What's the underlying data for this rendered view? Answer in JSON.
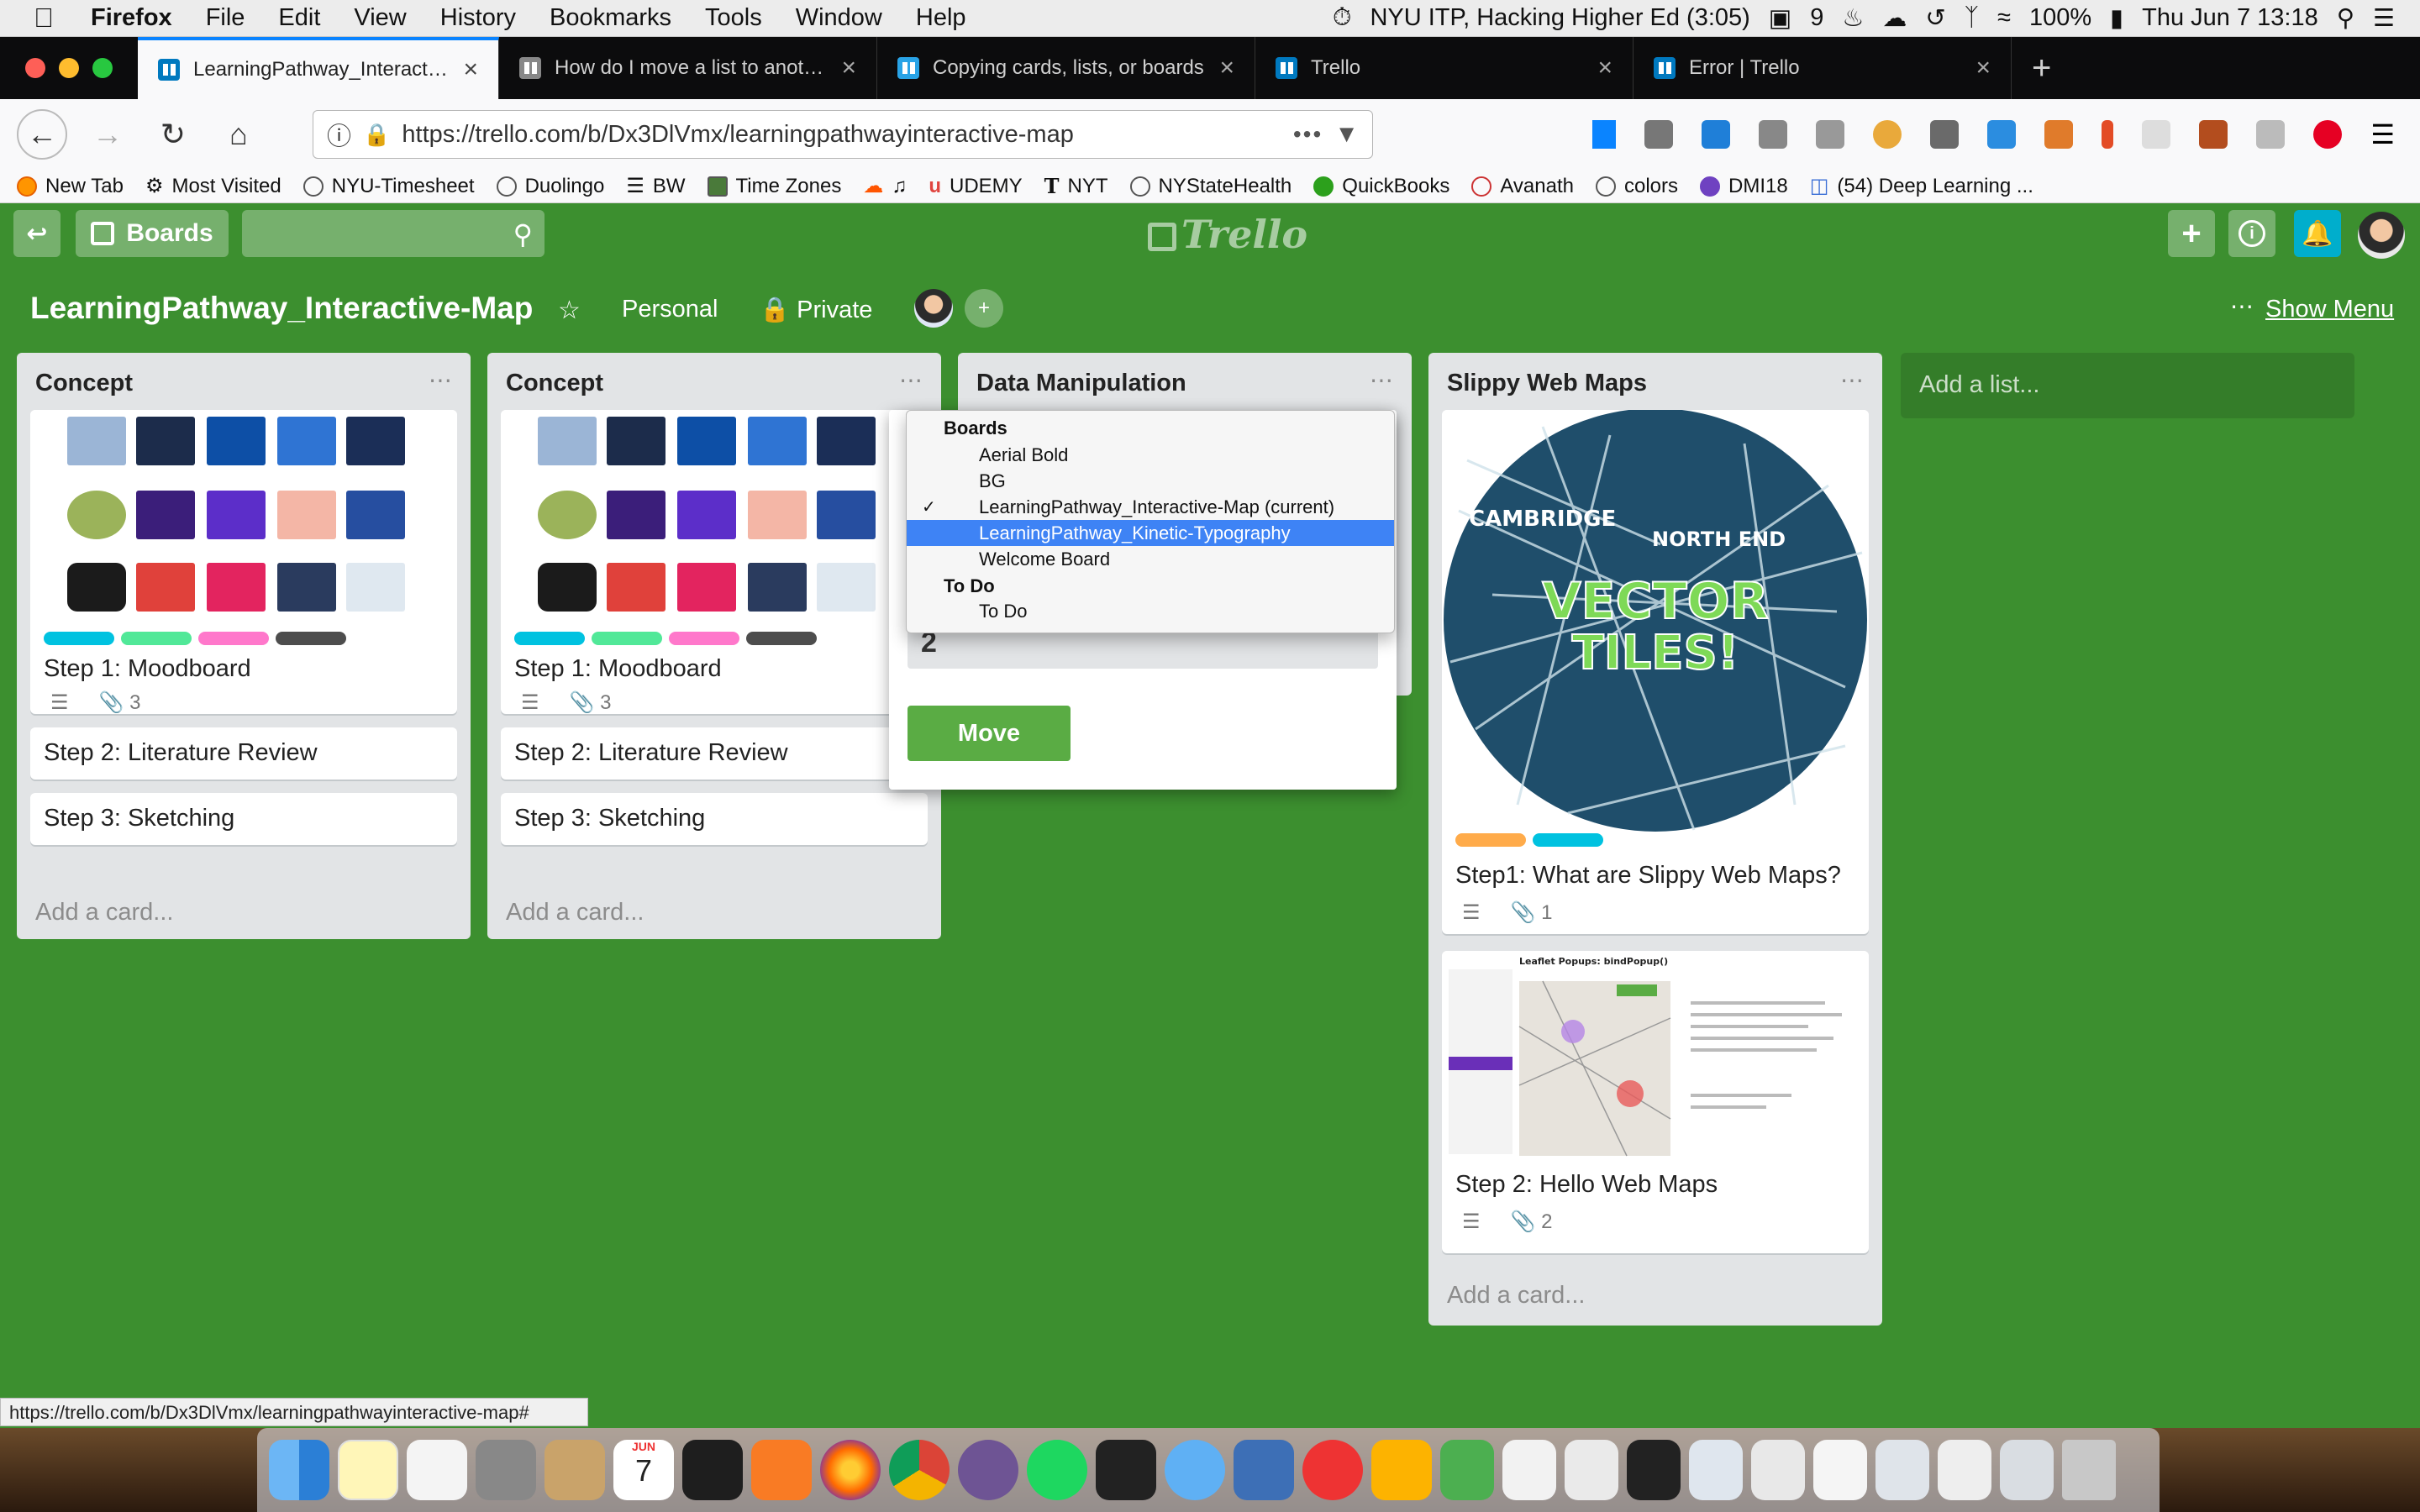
{
  "menubar": {
    "app": "Firefox",
    "items": [
      "File",
      "Edit",
      "View",
      "History",
      "Bookmarks",
      "Tools",
      "Window",
      "Help"
    ],
    "status_title": "NYU ITP, Hacking Higher Ed (3:05)",
    "adobe_count": "9",
    "battery": "100%",
    "datetime": "Thu Jun 7  13:18"
  },
  "tabs": [
    {
      "title": "LearningPathway_Interactive-Map",
      "active": true
    },
    {
      "title": "How do I move a list to another",
      "active": false
    },
    {
      "title": "Copying cards, lists, or boards",
      "active": false
    },
    {
      "title": "Trello",
      "active": false
    },
    {
      "title": "Error | Trello",
      "active": false
    }
  ],
  "nav": {
    "url": "https://trello.com/b/Dx3DlVmx/learningpathwayinteractive-map",
    "more": "•••"
  },
  "bookmarks": [
    "New Tab",
    "Most Visited",
    "NYU-Timesheet",
    "Duolingo",
    "BW",
    "Time Zones",
    "UDEMY",
    "NYT",
    "NYStateHealth",
    "QuickBooks",
    "Avanath",
    "colors",
    "DMI18",
    "(54) Deep Learning ..."
  ],
  "trello_header": {
    "boards_label": "Boards",
    "logo": "Trello",
    "add": "+",
    "info": "i"
  },
  "board": {
    "title": "LearningPathway_Interactive-Map",
    "visibility_team": "Personal",
    "privacy": "Private",
    "show_menu": "Show Menu",
    "add_list": "Add a list..."
  },
  "lists": [
    {
      "title": "Concept",
      "cards": [
        {
          "title": "Step 1: Moodboard",
          "attachments": "3"
        },
        {
          "title": "Step 2: Literature Review"
        },
        {
          "title": "Step 3: Sketching"
        }
      ],
      "add_card": "Add a card..."
    },
    {
      "title": "Concept",
      "cards": [
        {
          "title": "Step 1: Moodboard",
          "attachments": "3"
        },
        {
          "title": "Step 2: Literature Review"
        },
        {
          "title": "Step 3: Sketching"
        }
      ],
      "add_card": "Add a card..."
    },
    {
      "title": "Data Manipulation"
    },
    {
      "title": "Slippy Web Maps",
      "cards": [
        {
          "title": "Step1: What are Slippy Web Maps?",
          "attachments": "1",
          "image_text": [
            "CAMBRIDGE",
            "NORTH END",
            "VECTOR",
            "TILES!"
          ]
        },
        {
          "title": "Step 2: Hello Web Maps",
          "attachments": "2",
          "image_text": [
            "Leaflet Popups: bindPopup()"
          ]
        }
      ],
      "add_card": "Add a card..."
    }
  ],
  "move_popover": {
    "position_value": "2",
    "move_label": "Move"
  },
  "dropdown": {
    "group_boards": "Boards",
    "boards": [
      "Aerial Bold",
      "BG",
      "LearningPathway_Interactive-Map (current)",
      "LearningPathway_Kinetic-Typography",
      "Welcome Board"
    ],
    "checked_index": 2,
    "selected_index": 3,
    "group_todo": "To Do",
    "todo_items": [
      "To Do"
    ],
    "check": "✓"
  },
  "statusbar": "https://trello.com/b/Dx3DlVmx/learningpathwayinteractive-map#",
  "dock": {
    "calendar_month": "JUN",
    "calendar_day": "7"
  },
  "colors": {
    "board_bg": "#3c8f2f",
    "label_cyan": "#00c2e0",
    "label_green": "#51e898",
    "label_pink": "#ff78cb",
    "label_black": "#4d4d4d",
    "label_orange": "#ffab4a",
    "move_green": "#5aac44",
    "selection_blue": "#3e83f5"
  }
}
